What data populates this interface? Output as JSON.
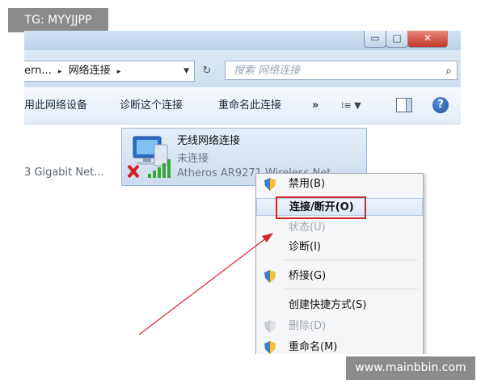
{
  "watermarks": {
    "top_left": "TG: MYYJJPP",
    "bottom_right": "www.mainbbin.com"
  },
  "titlebar": {
    "min": "▭",
    "max": "□",
    "close": "✕"
  },
  "address": {
    "segments": [
      "ern...",
      "▸",
      "网络连接",
      "▸"
    ],
    "dropdown": "▼",
    "refresh": "↻"
  },
  "search": {
    "placeholder": "搜索 网络连接",
    "icon": "⌕"
  },
  "toolbar": {
    "items": [
      "用此网络设备",
      "诊断这个连接",
      "重命名此连接"
    ],
    "more": "»",
    "view": "⁞≡ ▼",
    "help": "?"
  },
  "content": {
    "left_label": "3 Gigabit Net...",
    "connection": {
      "name": "无线网络连接",
      "status": "未连接",
      "adapter": "Atheros AR9271 Wireless Net"
    }
  },
  "context_menu": {
    "items": [
      {
        "label": "禁用(B)",
        "shield": true,
        "disabled": false
      },
      {
        "label": "连接/断开(O)",
        "shield": false,
        "disabled": false,
        "highlighted": true
      },
      {
        "label": "状态(U)",
        "shield": false,
        "disabled": true
      },
      {
        "label": "诊断(I)",
        "shield": false,
        "disabled": false
      },
      {
        "label": "桥接(G)",
        "shield": true,
        "disabled": false
      },
      {
        "label": "创建快捷方式(S)",
        "shield": false,
        "disabled": false
      },
      {
        "label": "删除(D)",
        "shield": true,
        "disabled": true
      },
      {
        "label": "重命名(M)",
        "shield": true,
        "disabled": false
      }
    ]
  },
  "colors": {
    "highlight_border": "#d6262b",
    "arrow": "#d6262b",
    "toolbar_bg": "#e3ecf6"
  }
}
